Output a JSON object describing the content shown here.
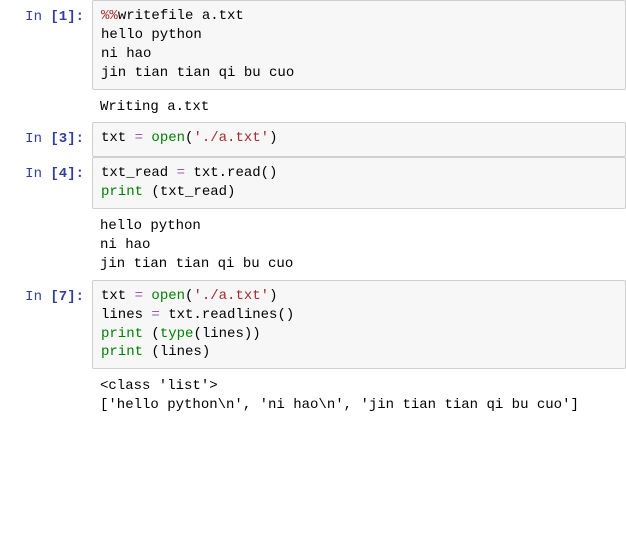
{
  "cells": [
    {
      "prompt": {
        "label": "In  ",
        "num": "[1]:"
      },
      "code_tokens": [
        [
          {
            "cls": "tok-magic",
            "t": "%%"
          },
          {
            "cls": "tok-plain",
            "t": "writefile a.txt"
          }
        ],
        [
          {
            "cls": "tok-plain",
            "t": "hello python"
          }
        ],
        [
          {
            "cls": "tok-plain",
            "t": "ni hao"
          }
        ],
        [
          {
            "cls": "tok-plain",
            "t": "jin tian tian qi bu cuo"
          }
        ]
      ],
      "output": [
        "Writing a.txt"
      ]
    },
    {
      "prompt": {
        "label": "In  ",
        "num": "[3]:"
      },
      "code_tokens": [
        [
          {
            "cls": "tok-plain",
            "t": "txt "
          },
          {
            "cls": "tok-op",
            "t": "="
          },
          {
            "cls": "tok-plain",
            "t": " "
          },
          {
            "cls": "tok-builtin",
            "t": "open"
          },
          {
            "cls": "tok-plain",
            "t": "("
          },
          {
            "cls": "tok-str",
            "t": "'./a.txt'"
          },
          {
            "cls": "tok-plain",
            "t": ")"
          }
        ]
      ],
      "output": []
    },
    {
      "prompt": {
        "label": "In  ",
        "num": "[4]:"
      },
      "code_tokens": [
        [
          {
            "cls": "tok-plain",
            "t": "txt_read "
          },
          {
            "cls": "tok-op",
            "t": "="
          },
          {
            "cls": "tok-plain",
            "t": " txt.read()"
          }
        ],
        [
          {
            "cls": "tok-builtin",
            "t": "print"
          },
          {
            "cls": "tok-plain",
            "t": " (txt_read)"
          }
        ]
      ],
      "output": [
        "hello python",
        "ni hao",
        "jin tian tian qi bu cuo"
      ]
    },
    {
      "prompt": {
        "label": "In  ",
        "num": "[7]:"
      },
      "code_tokens": [
        [
          {
            "cls": "tok-plain",
            "t": "txt "
          },
          {
            "cls": "tok-op",
            "t": "="
          },
          {
            "cls": "tok-plain",
            "t": " "
          },
          {
            "cls": "tok-builtin",
            "t": "open"
          },
          {
            "cls": "tok-plain",
            "t": "("
          },
          {
            "cls": "tok-str",
            "t": "'./a.txt'"
          },
          {
            "cls": "tok-plain",
            "t": ")"
          }
        ],
        [
          {
            "cls": "tok-plain",
            "t": "lines "
          },
          {
            "cls": "tok-op",
            "t": "="
          },
          {
            "cls": "tok-plain",
            "t": " txt.readlines()"
          }
        ],
        [
          {
            "cls": "tok-builtin",
            "t": "print"
          },
          {
            "cls": "tok-plain",
            "t": " ("
          },
          {
            "cls": "tok-builtin",
            "t": "type"
          },
          {
            "cls": "tok-plain",
            "t": "(lines))"
          }
        ],
        [
          {
            "cls": "tok-builtin",
            "t": "print"
          },
          {
            "cls": "tok-plain",
            "t": " (lines)"
          }
        ]
      ],
      "output": [
        "<class 'list'>",
        "['hello python\\n', 'ni hao\\n', 'jin tian tian qi bu cuo']"
      ]
    }
  ]
}
